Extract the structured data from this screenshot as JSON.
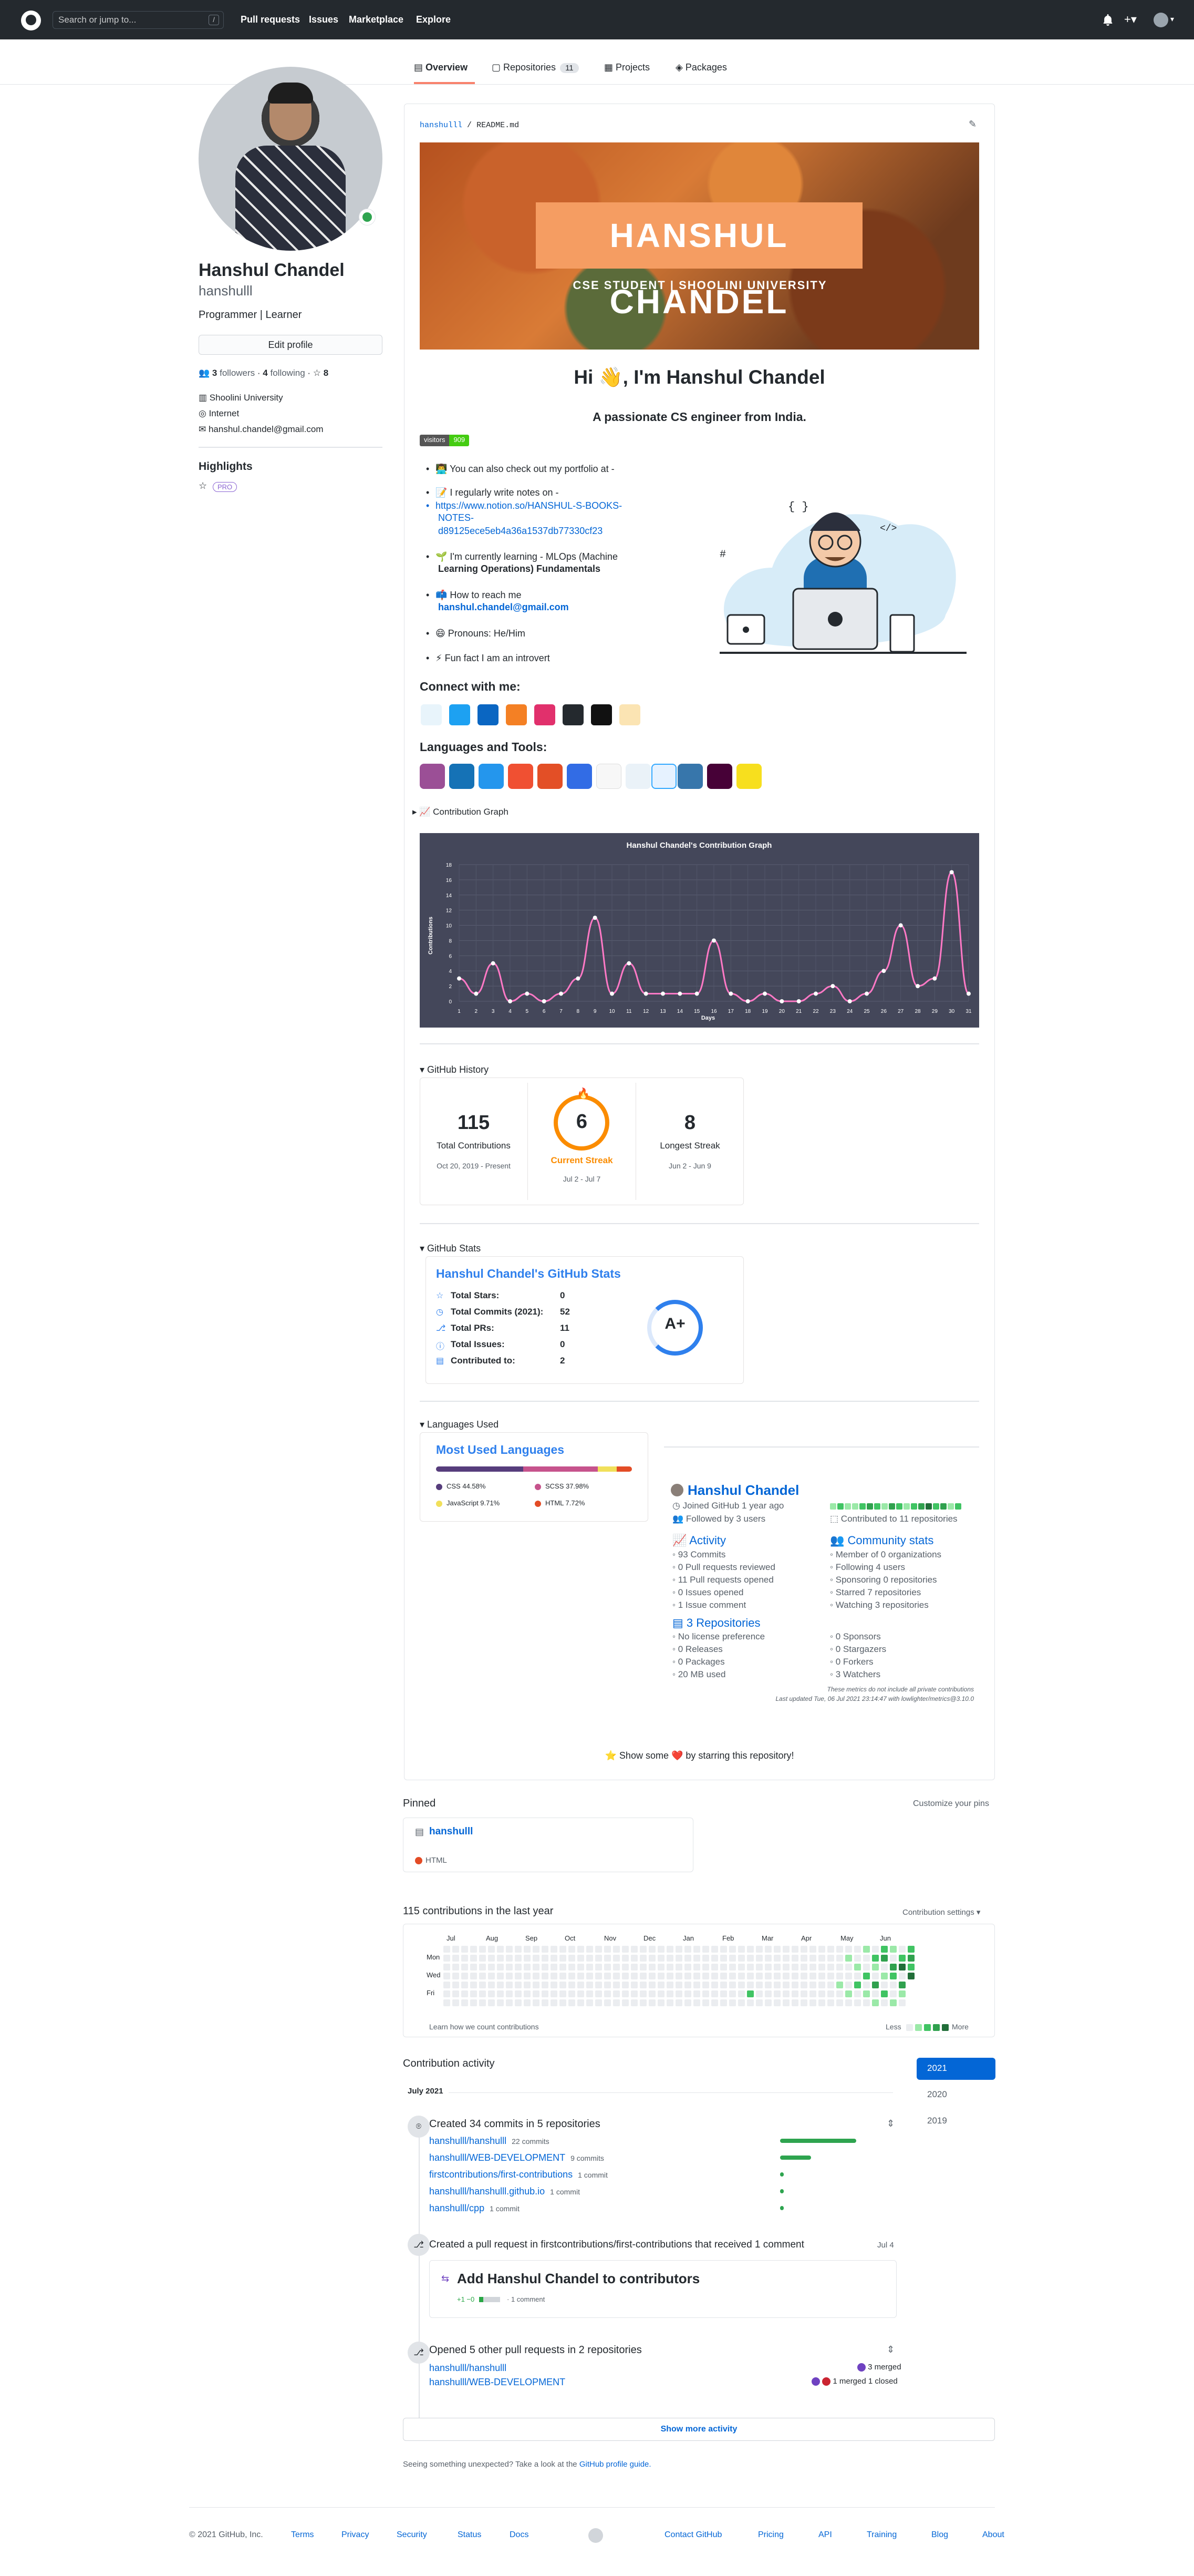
{
  "header": {
    "search_placeholder": "Search or jump to...",
    "search_shortcut": "/",
    "nav": [
      "Pull requests",
      "Issues",
      "Marketplace",
      "Explore"
    ],
    "plus_label": "+▾"
  },
  "tabs": [
    {
      "label": "Overview"
    },
    {
      "label": "Repositories",
      "count": "11"
    },
    {
      "label": "Projects"
    },
    {
      "label": "Packages"
    }
  ],
  "profile": {
    "name": "Hanshul Chandel",
    "username": "hanshulll",
    "bio": "Programmer | Learner",
    "edit_button": "Edit profile",
    "followers_count": "3",
    "followers_label": "followers",
    "following_count": "4",
    "following_label": "following",
    "stars_count": "8",
    "organization": "Shoolini University",
    "location": "Internet",
    "email": "hanshul.chandel@gmail.com",
    "highlights_title": "Highlights",
    "pro_badge": "PRO"
  },
  "readme": {
    "path_user": "hanshulll",
    "path_sep": "/",
    "path_file": "README.md",
    "banner_title": "HANSHUL CHANDEL",
    "banner_subtitle": "CSE STUDENT  |  SHOOLINI UNIVERSITY",
    "greeting": "Hi 👋, I'm Hanshul Chandel",
    "tagline": "A passionate CS engineer from India.",
    "visitors_label": "visitors",
    "visitors_count": "909",
    "bullets": {
      "portfolio": "👨‍💻 You can also check out my portfolio at -",
      "notes_label": "📝 I regularly write notes on -",
      "notes_link_1": "https://www.notion.so/HANSHUL-S-BOOKS-",
      "notes_link_2": "NOTES-",
      "notes_link_3": "d89125ece5eb4a36a1537db77330cf23",
      "learning_1": "🌱 I'm currently learning - MLOps (Machine",
      "learning_2": "Learning Operations) Fundamentals",
      "reach_label": "📫 How to reach me",
      "reach_email": "hanshul.chandel@gmail.com",
      "pronouns": "😄 Pronouns: He/Him",
      "fun_fact": "⚡ Fun fact I am an introvert"
    },
    "connect_title": "Connect with me:",
    "tools_title": "Languages and Tools:",
    "contribution_graph_label": "📈 Contribution Graph",
    "show_some_love": "⭐ Show some ❤️ by starring this repository!"
  },
  "colors": {
    "header_bg": "#24292e",
    "link": "#0366d6",
    "tab_active_border": "#f9826c",
    "chart_bg": "#44475a",
    "chart_line": "#ff79c6",
    "streak_orange": "#fb8c00",
    "green_0": "#ebedf0",
    "green_1": "#9be9a8",
    "green_2": "#40c463",
    "green_3": "#30a14e",
    "green_4": "#216e39"
  },
  "chart_data": {
    "type": "line",
    "title": "Hanshul Chandel's Contribution Graph",
    "xlabel": "Days",
    "ylabel": "Contributions",
    "x": [
      1,
      2,
      3,
      4,
      5,
      6,
      7,
      8,
      9,
      10,
      11,
      12,
      13,
      14,
      15,
      16,
      17,
      18,
      19,
      20,
      21,
      22,
      23,
      24,
      25,
      26,
      27,
      28,
      29,
      30,
      31
    ],
    "values": [
      3,
      1,
      5,
      0,
      1,
      0,
      1,
      3,
      11,
      1,
      5,
      1,
      1,
      1,
      1,
      8,
      1,
      0,
      1,
      0,
      0,
      1,
      2,
      0,
      1,
      4,
      10,
      2,
      3,
      17,
      1
    ],
    "ylim": [
      0,
      18
    ],
    "yticks": [
      0,
      2,
      4,
      6,
      8,
      10,
      12,
      14,
      16,
      18
    ]
  },
  "github_history": {
    "title": "GitHub History",
    "total": "115",
    "total_label": "Total Contributions",
    "total_range": "Oct 20, 2019 - Present",
    "current": "6",
    "current_label": "Current Streak",
    "current_range": "Jul 2 - Jul 7",
    "longest": "8",
    "longest_label": "Longest Streak",
    "longest_range": "Jun 2 - Jun 9"
  },
  "github_stats": {
    "title": "GitHub Stats",
    "card_title": "Hanshul Chandel's GitHub Stats",
    "rows": [
      {
        "label": "Total Stars:",
        "value": "0"
      },
      {
        "label": "Total Commits (2021):",
        "value": "52"
      },
      {
        "label": "Total PRs:",
        "value": "11"
      },
      {
        "label": "Total Issues:",
        "value": "0"
      },
      {
        "label": "Contributed to:",
        "value": "2"
      }
    ],
    "grade": "A+"
  },
  "languages_used": {
    "title": "Languages Used",
    "card_title": "Most Used Languages",
    "langs": [
      {
        "name": "CSS 44.58%",
        "color": "#563d7c",
        "pct": 44.58
      },
      {
        "name": "SCSS 37.98%",
        "color": "#c6538c",
        "pct": 37.98
      },
      {
        "name": "JavaScript 9.71%",
        "color": "#f1e05a",
        "pct": 9.71
      },
      {
        "name": "HTML 7.72%",
        "color": "#e34c26",
        "pct": 7.72
      }
    ]
  },
  "metrics": {
    "name": "Hanshul Chandel",
    "joined": "Joined GitHub 1 year ago",
    "followed": "Followed by 3 users",
    "contributed": "Contributed to 11 repositories",
    "activity_title": "Activity",
    "activity": [
      "93 Commits",
      "0 Pull requests reviewed",
      "11 Pull requests opened",
      "0 Issues opened",
      "1 Issue comment"
    ],
    "community_title": "Community stats",
    "community": [
      "Member of 0 organizations",
      "Following 4 users",
      "Sponsoring 0 repositories",
      "Starred 7 repositories",
      "Watching 3 repositories"
    ],
    "repos_title": "3 Repositories",
    "repos": [
      "No license preference",
      "0 Releases",
      "0 Packages",
      "20 MB used"
    ],
    "repos_right": [
      "0 Sponsors",
      "0 Stargazers",
      "0 Forkers",
      "3 Watchers"
    ],
    "footnote_1": "These metrics do not include all private contributions",
    "footnote_2": "Last updated Tue, 06 Jul 2021 23:14:47 with lowlighter/metrics@3.10.0"
  },
  "pinned": {
    "title": "Pinned",
    "customize": "Customize your pins",
    "repo": "hanshulll",
    "language": "HTML"
  },
  "contributions": {
    "title": "115 contributions in the last year",
    "settings": "Contribution settings ▾",
    "months": [
      "Jul",
      "Aug",
      "Sep",
      "Oct",
      "Nov",
      "Dec",
      "Jan",
      "Feb",
      "Mar",
      "Apr",
      "May",
      "Jun"
    ],
    "days": [
      "Mon",
      "Wed",
      "Fri"
    ],
    "learn": "Learn how we count contributions",
    "less": "Less",
    "more": "More"
  },
  "activity": {
    "title": "Contribution activity",
    "month": "July 2021",
    "years": [
      "2021",
      "2020",
      "2019"
    ],
    "commits_title": "Created 34 commits in 5 repositories",
    "commit_repos": [
      {
        "repo": "hanshulll/hanshulll",
        "count": "22 commits",
        "pct": 1.0
      },
      {
        "repo": "hanshulll/WEB-DEVELOPMENT",
        "count": "9 commits",
        "pct": 0.41
      },
      {
        "repo": "firstcontributions/first-contributions",
        "count": "1 commit",
        "pct": 0.05
      },
      {
        "repo": "hanshulll/hanshulll.github.io",
        "count": "1 commit",
        "pct": 0.05
      },
      {
        "repo": "hanshulll/cpp",
        "count": "1 commit",
        "pct": 0.05
      }
    ],
    "pr_title": "Created a pull request in firstcontributions/first-contributions that received 1 comment",
    "pr_date": "Jul 4",
    "pr_name": "Add Hanshul Chandel to contributors",
    "pr_diff": "+1 −0",
    "pr_comment": "1 comment",
    "opened_title": "Opened 5 other pull requests in 2 repositories",
    "opened_repos": [
      {
        "repo": "hanshulll/hanshulll",
        "status": "3 merged"
      },
      {
        "repo": "hanshulll/WEB-DEVELOPMENT",
        "status": "1 merged  1 closed"
      }
    ],
    "show_more": "Show more activity",
    "unexpected": "Seeing something unexpected? Take a look at the",
    "guide_link": "GitHub profile guide."
  },
  "footer": {
    "copyright": "© 2021 GitHub, Inc.",
    "links_left": [
      "Terms",
      "Privacy",
      "Security",
      "Status",
      "Docs"
    ],
    "links_right": [
      "Contact GitHub",
      "Pricing",
      "API",
      "Training",
      "Blog",
      "About"
    ]
  }
}
